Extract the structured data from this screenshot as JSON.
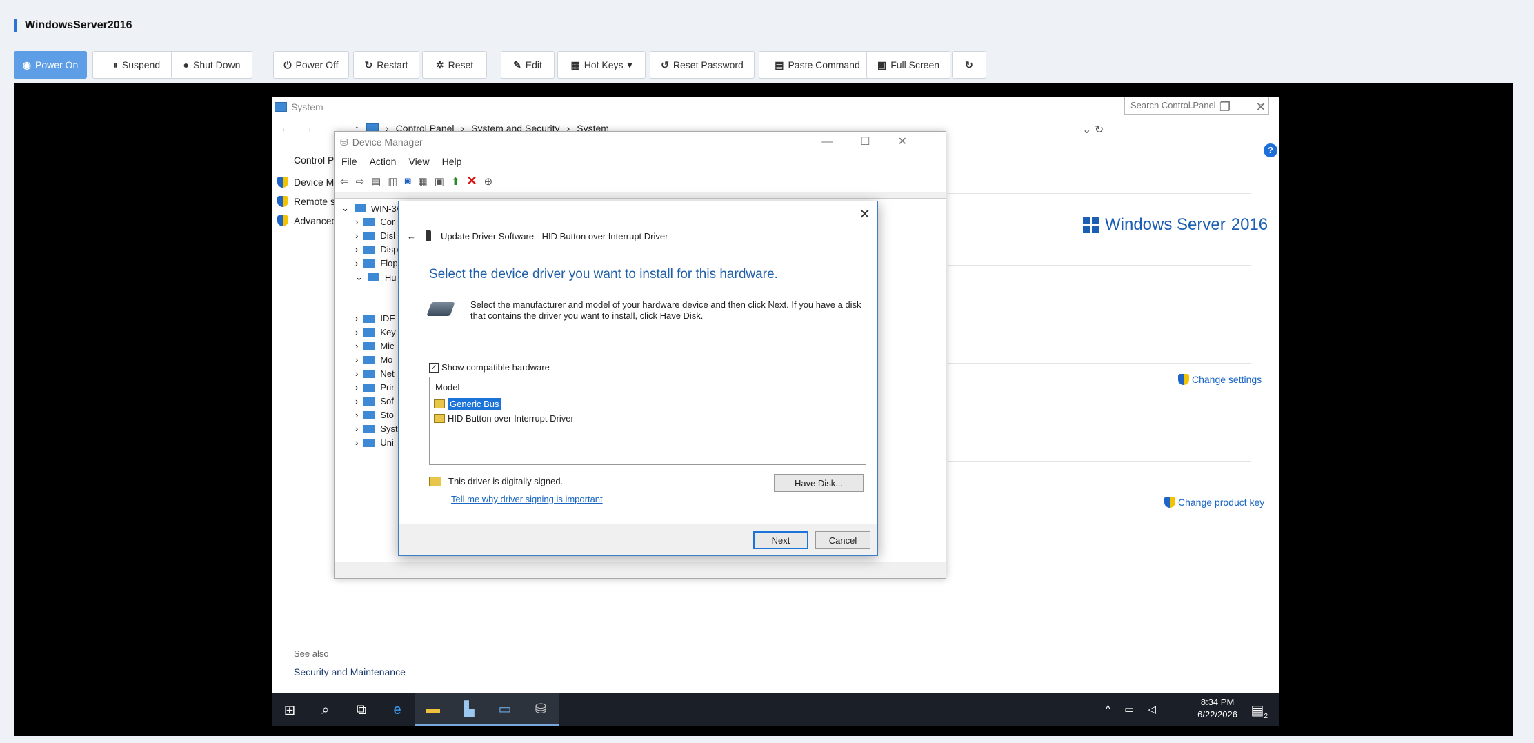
{
  "header": {
    "title": "WindowsServer2016"
  },
  "toolbar": {
    "power_on": "Power On",
    "suspend": "Suspend",
    "shut_down": "Shut Down",
    "power_off": "Power Off",
    "restart": "Restart",
    "reset": "Reset",
    "edit": "Edit",
    "hot_keys": "Hot Keys",
    "reset_password": "Reset Password",
    "paste_command": "Paste Command",
    "full_screen": "Full Screen"
  },
  "system_window": {
    "title": "System",
    "breadcrumbs": [
      "Control Panel",
      "System and Security",
      "System"
    ],
    "search_placeholder": "Search Control Panel",
    "control_panel_home": "Control P",
    "left_links": [
      "Device M",
      "Remote s",
      "Advanced"
    ],
    "brand": "Windows Server",
    "brand_year": "2016",
    "change_settings": "Change settings",
    "change_product_key": "Change product key",
    "see_also": "See also",
    "security_maintenance": "Security and Maintenance"
  },
  "device_manager": {
    "title": "Device Manager",
    "menu": [
      "File",
      "Action",
      "View",
      "Help"
    ],
    "root": "WIN-3/",
    "tree": [
      "Cor",
      "Disl",
      "Disp",
      "Flop",
      "Hu",
      "IDE",
      "Key",
      "Mic",
      "Mo",
      "Net",
      "Prir",
      "Sof",
      "Sto",
      "Syst",
      "Uni"
    ]
  },
  "update_dialog": {
    "header": "Update Driver Software - HID Button over Interrupt Driver",
    "heading": "Select the device driver you want to install for this hardware.",
    "description": "Select the manufacturer and model of your hardware device and then click Next. If you have a disk that contains the driver you want to install, click Have Disk.",
    "show_compatible": "Show compatible hardware",
    "model_header": "Model",
    "models": [
      "Generic Bus",
      "HID Button over Interrupt Driver"
    ],
    "signed_text": "This driver is digitally signed.",
    "signing_link": "Tell me why driver signing is important",
    "have_disk": "Have Disk...",
    "next": "Next",
    "cancel": "Cancel"
  },
  "taskbar": {
    "time": "8:34 PM",
    "date": "6/22/2026",
    "notifications": "2"
  }
}
